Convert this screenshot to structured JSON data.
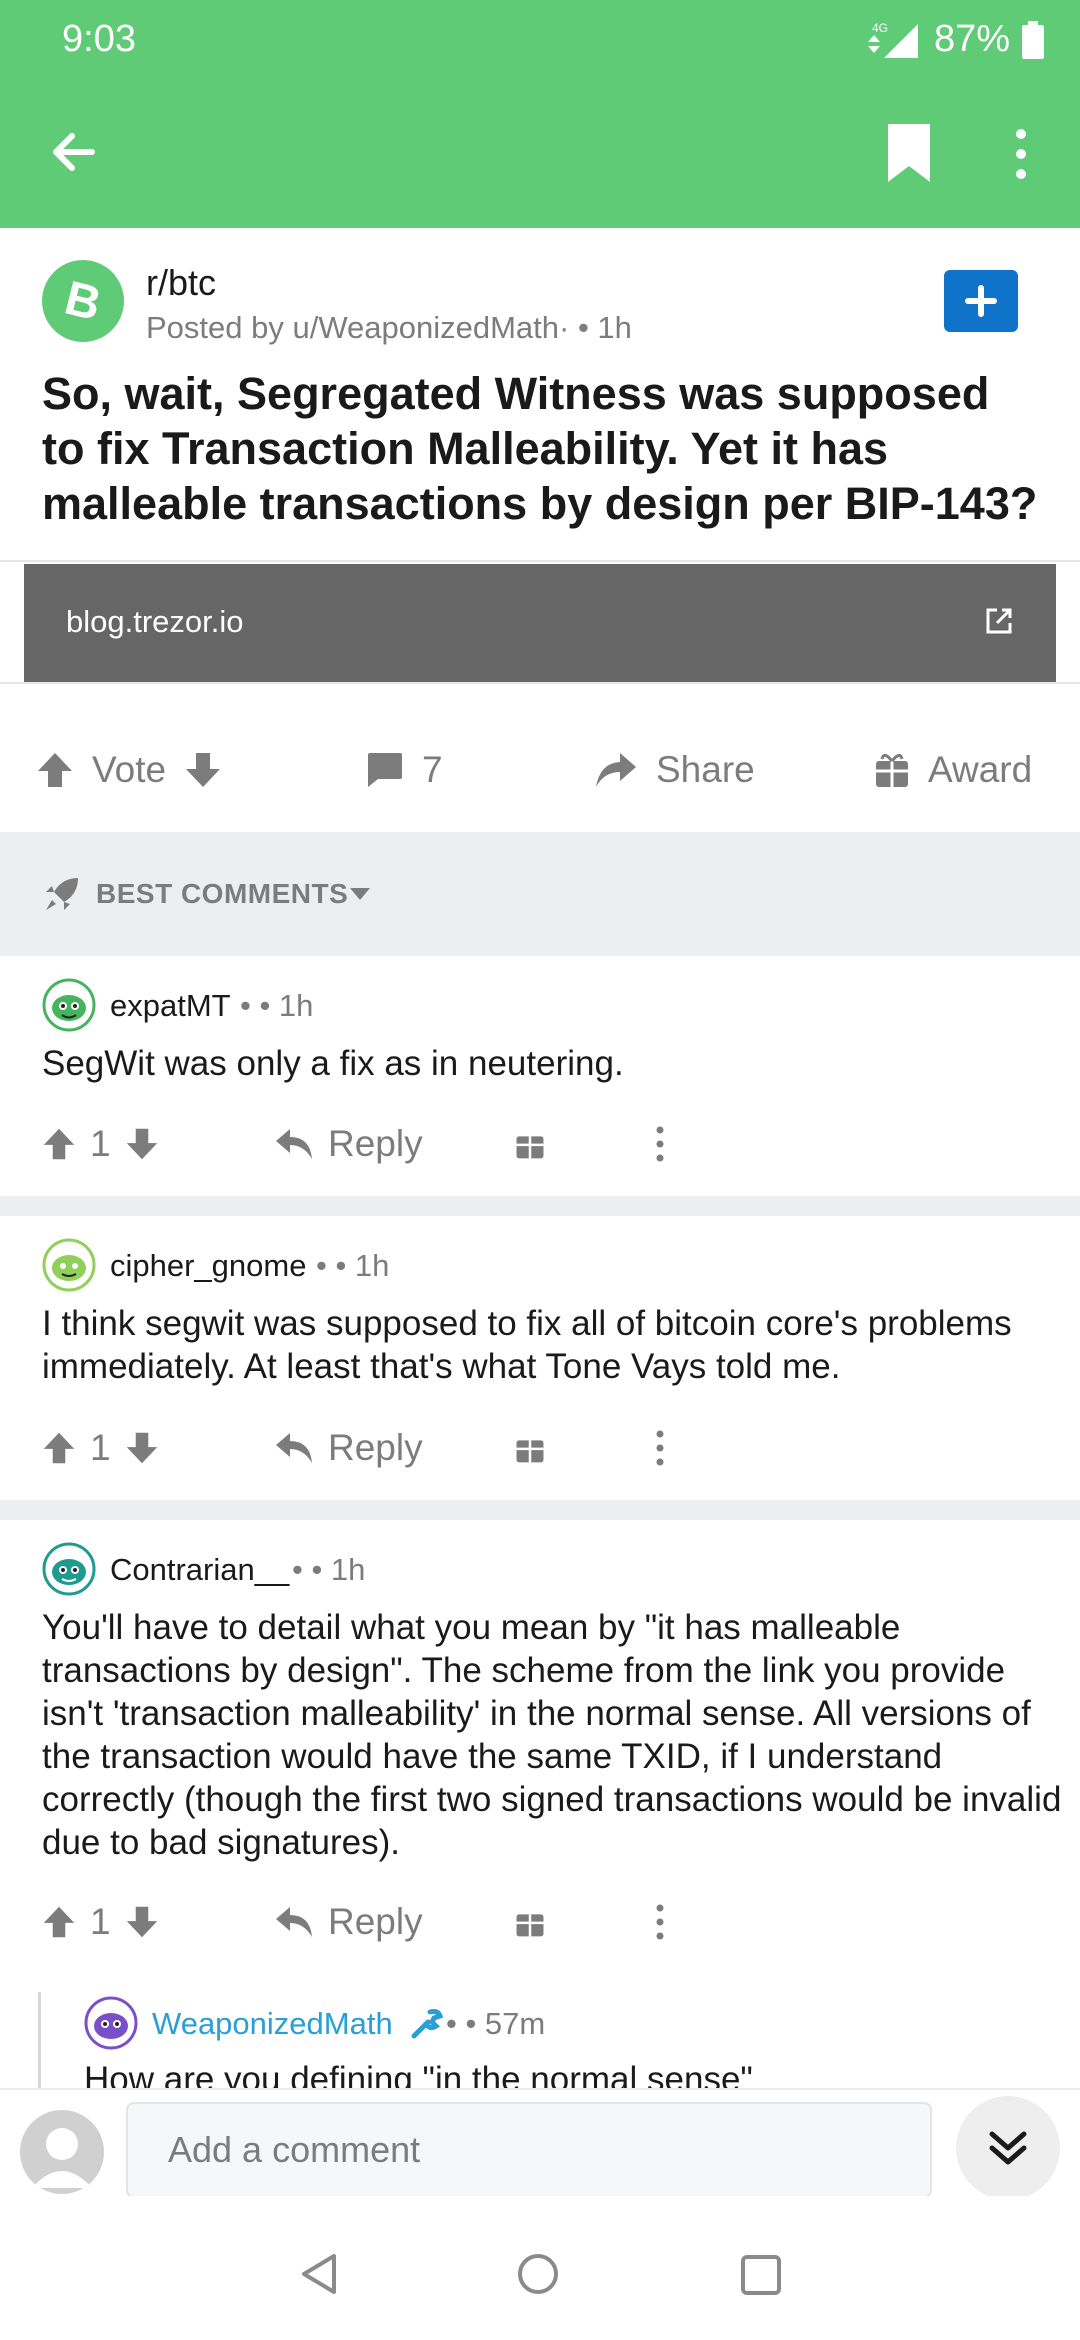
{
  "status": {
    "time": "9:03",
    "battery": "87%",
    "network": "4G"
  },
  "post": {
    "subreddit": "r/btc",
    "posted_by": "Posted by u/WeaponizedMath·  • 1h",
    "title": "So, wait, Segregated Witness was supposed to fix Transaction Malleability. Yet it has malleable transactions by design per BIP-143?",
    "link_domain": "blog.trezor.io"
  },
  "actions": {
    "vote": "Vote",
    "comments": "7",
    "share": "Share",
    "award": "Award"
  },
  "sort": {
    "label": "BEST COMMENTS"
  },
  "comments": [
    {
      "author": "expatMT",
      "meta": "•  • 1h",
      "body": "SegWit was only a fix as in neutering.",
      "score": "1",
      "reply": "Reply"
    },
    {
      "author": "cipher_gnome",
      "meta": "•  • 1h",
      "body": "I think segwit was supposed to fix all of bitcoin core's problems immediately. At least that's what Tone Vays told me.",
      "score": "1",
      "reply": "Reply"
    },
    {
      "author": "Contrarian__",
      "meta": "•  • 1h",
      "body": "You'll have to detail what you mean by \"it has malleable transactions by design\". The scheme from the link you provide isn't 'transaction malleability' in the normal sense. All versions of the transaction would have the same TXID, if I understand correctly (though the first two signed transactions would be invalid due to bad signatures).",
      "score": "1",
      "reply": "Reply"
    },
    {
      "author": "WeaponizedMath",
      "meta": "•  • 57m",
      "body": "How are you defining \"in the normal sense\""
    }
  ],
  "composer": {
    "placeholder": "Add a comment"
  },
  "colors": {
    "header": "#5fcb77",
    "link_author": "#2a9fd6",
    "join": "#0f73c9"
  }
}
